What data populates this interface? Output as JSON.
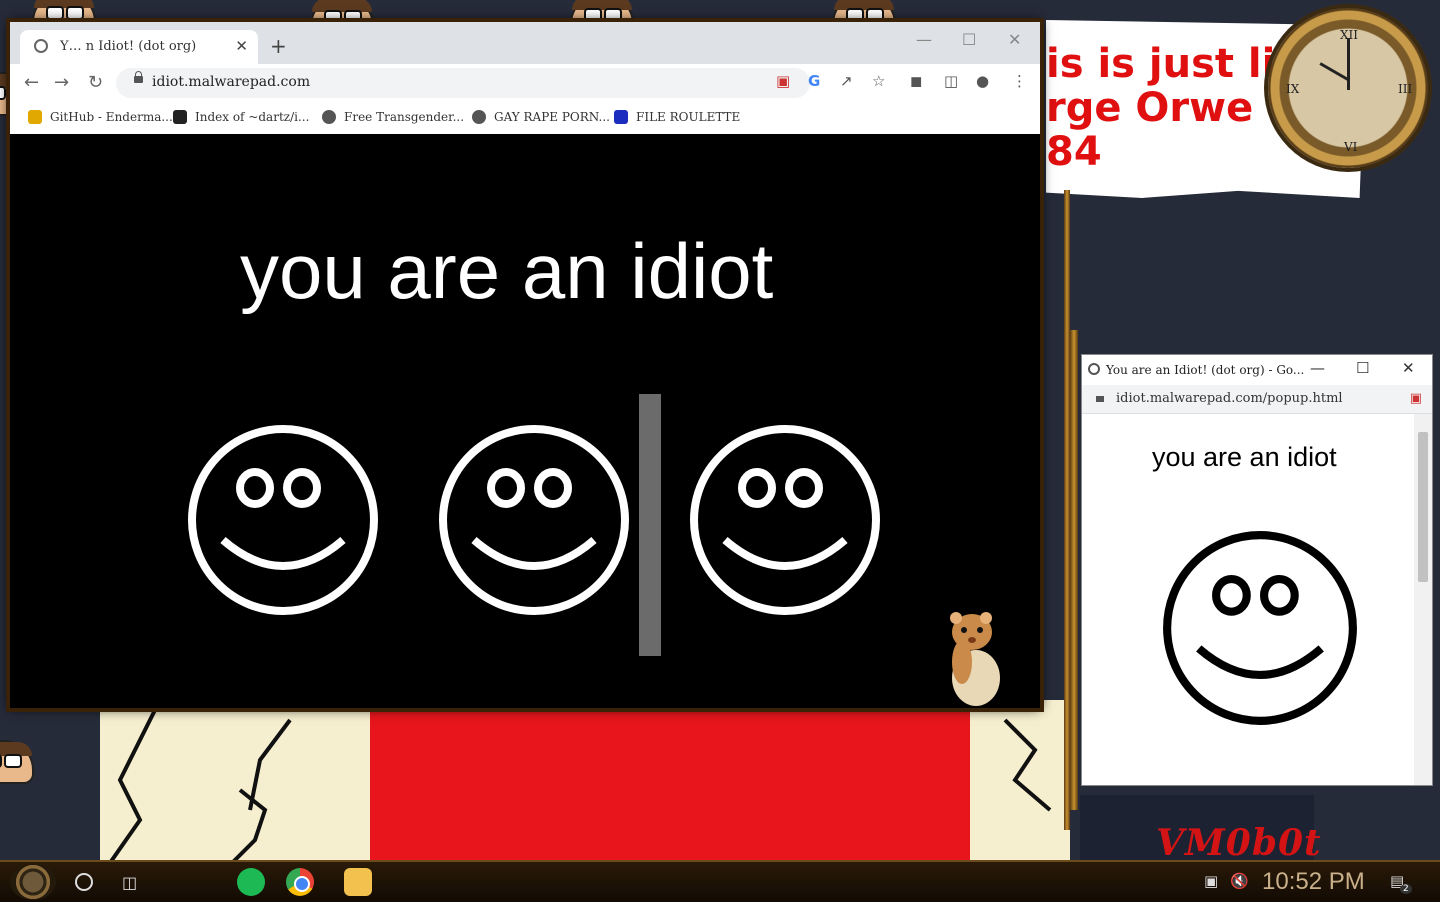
{
  "desktop": {
    "note_lines": [
      "is is just li",
      "rge Orwe",
      "84"
    ],
    "vm_label": "VM0b0t"
  },
  "browser": {
    "tab": {
      "title": "Y… n Idiot! (dot org)",
      "close": "✕"
    },
    "new_tab": "+",
    "window_controls": {
      "minimize": "—",
      "maximize": "☐",
      "close": "✕"
    },
    "address": "idiot.malwarepad.com",
    "bookmarks": [
      {
        "label": "GitHub - Enderma...",
        "icon": "bookmark-favicon-icon",
        "color": "#e0a800"
      },
      {
        "label": "Index of ~dartz/i...",
        "icon": "bookmark-favicon-icon",
        "color": "#222222"
      },
      {
        "label": "Free Transgender...",
        "icon": "bookmark-favicon-icon",
        "color": "#555555"
      },
      {
        "label": "GAY RAPE PORN...",
        "icon": "globe-icon",
        "color": "#555555"
      },
      {
        "label": "FILE ROULETTE",
        "icon": "bookmark-favicon-icon",
        "color": "#1a2dbf"
      }
    ],
    "headline": "you are an idiot"
  },
  "popup": {
    "title": "You are an Idiot! (dot org) - Go...",
    "address": "idiot.malwarepad.com/popup.html",
    "headline": "you are an idiot",
    "controls": {
      "minimize": "—",
      "maximize": "☐",
      "close": "✕"
    }
  },
  "taskbar": {
    "time": "10:52 PM",
    "notification_count": "2"
  },
  "colors": {
    "accent_red": "#e8161c",
    "page_bg": "#000000",
    "clock_text": "#c9b08a"
  }
}
